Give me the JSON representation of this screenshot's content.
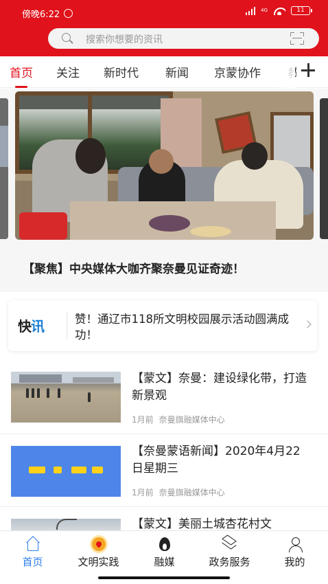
{
  "status_bar": {
    "time": "傍晚6:22",
    "network_label": "4G",
    "battery": "11"
  },
  "search": {
    "placeholder": "搜索你想要的资讯"
  },
  "tabs": [
    {
      "label": "首页",
      "active": true
    },
    {
      "label": "关注",
      "active": false
    },
    {
      "label": "新时代",
      "active": false
    },
    {
      "label": "新闻",
      "active": false
    },
    {
      "label": "京蒙协作",
      "active": false
    },
    {
      "label": "教",
      "active": false
    }
  ],
  "banner": {
    "headline": "【聚焦】中央媒体大咖齐聚奈曼见证奇迹！"
  },
  "flash_news": {
    "logo_text_a": "快",
    "logo_text_b": "讯",
    "text": "赞！通辽市118所文明校园展示活动圆满成功！"
  },
  "news_list": [
    {
      "title": "【蒙文】奈曼：建设绿化带，打造新景观",
      "time": "1月前",
      "source": "奈曼旗融媒体中心",
      "thumb": "field-photo"
    },
    {
      "title": "【奈曼蒙语新闻】2020年4月22日星期三",
      "time": "1月前",
      "source": "奈曼旗融媒体中心",
      "thumb": "mongolian-script-banner"
    },
    {
      "title": "【蒙文】美丽土城杏花村文",
      "time": "",
      "source": "",
      "thumb": "tree-photo"
    }
  ],
  "bottom_nav": [
    {
      "label": "首页",
      "icon": "home-icon",
      "active": true
    },
    {
      "label": "文明实践",
      "icon": "civilization-icon",
      "active": false
    },
    {
      "label": "融媒",
      "icon": "media-fire-icon",
      "active": false
    },
    {
      "label": "政务服务",
      "icon": "layers-icon",
      "active": false
    },
    {
      "label": "我的",
      "icon": "user-icon",
      "active": false
    }
  ],
  "colors": {
    "brand_red": "#e0121b",
    "nav_active_blue": "#2f80ed",
    "flash_logo_blue": "#1c7fd6"
  }
}
